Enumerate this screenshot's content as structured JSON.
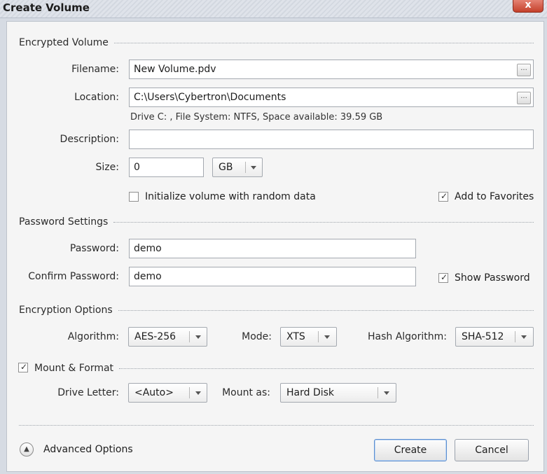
{
  "window": {
    "title": "Create Volume",
    "close_glyph": "x"
  },
  "sections": {
    "encrypted_volume": "Encrypted Volume",
    "password_settings": "Password Settings",
    "encryption_options": "Encryption Options",
    "mount_format": "Mount & Format"
  },
  "volume": {
    "filename_label": "Filename:",
    "filename_value": "New Volume.pdv",
    "location_label": "Location:",
    "location_value": "C:\\Users\\Cybertron\\Documents",
    "drive_info": "Drive C: , File System: NTFS, Space available: 39.59 GB",
    "description_label": "Description:",
    "description_value": "",
    "size_label": "Size:",
    "size_value": "0",
    "size_unit": "GB",
    "random_data_label": "Initialize volume with random data",
    "random_data_checked": false,
    "favorites_label": "Add to Favorites",
    "favorites_checked": true,
    "browse_glyph": "..."
  },
  "password": {
    "password_label": "Password:",
    "password_value": "demo",
    "confirm_label": "Confirm Password:",
    "confirm_value": "demo",
    "show_label": "Show Password",
    "show_checked": true
  },
  "encryption": {
    "algorithm_label": "Algorithm:",
    "algorithm_value": "AES-256",
    "mode_label": "Mode:",
    "mode_value": "XTS",
    "hash_label": "Hash Algorithm:",
    "hash_value": "SHA-512"
  },
  "mount": {
    "mount_format_checked": true,
    "drive_letter_label": "Drive Letter:",
    "drive_letter_value": "<Auto>",
    "mount_as_label": "Mount as:",
    "mount_as_value": "Hard Disk"
  },
  "footer": {
    "advanced_label": "Advanced Options",
    "create_label": "Create",
    "cancel_label": "Cancel"
  },
  "icons": {
    "close": "close-icon",
    "browse": "ellipsis-icon",
    "dropdown": "chevron-down-icon",
    "check": "checkmark-icon",
    "advanced": "chevron-up-circle-icon"
  },
  "colors": {
    "title_bar": "#d9dde4",
    "close_button": "#c4402b",
    "dialog_background": "#f5f5f5",
    "primary_button_border": "#5b8ecf"
  }
}
